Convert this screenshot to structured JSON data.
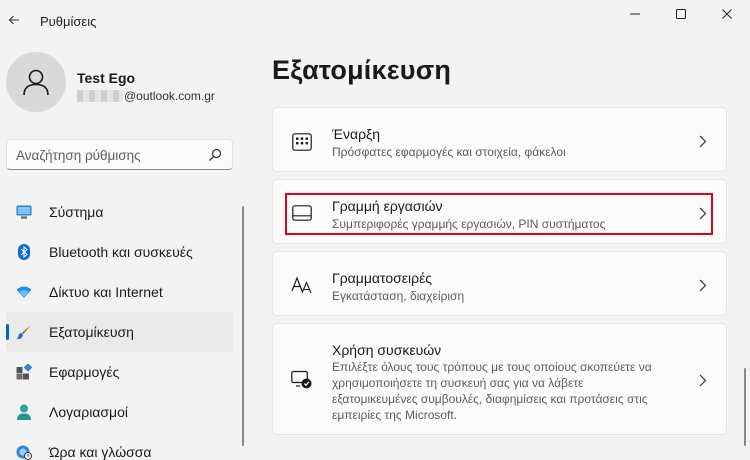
{
  "window": {
    "title": "Ρυθμίσεις"
  },
  "user": {
    "name": "Test Ego",
    "email_domain": "@outlook.com.gr"
  },
  "search": {
    "placeholder": "Αναζήτηση ρύθμισης"
  },
  "sidebar": {
    "items": [
      {
        "label": "Σύστημα",
        "icon": "system-icon",
        "active": false
      },
      {
        "label": "Bluetooth και συσκευές",
        "icon": "bluetooth-icon",
        "active": false
      },
      {
        "label": "Δίκτυο και Internet",
        "icon": "wifi-icon",
        "active": false
      },
      {
        "label": "Εξατομίκευση",
        "icon": "brush-icon",
        "active": true
      },
      {
        "label": "Εφαρμογές",
        "icon": "apps-icon",
        "active": false
      },
      {
        "label": "Λογαριασμοί",
        "icon": "person-icon",
        "active": false
      },
      {
        "label": "Ώρα και γλώσσα",
        "icon": "globe-clock-icon",
        "active": false
      }
    ]
  },
  "main": {
    "title": "Εξατομίκευση",
    "cards": [
      {
        "title": "Έναρξη",
        "desc": "Πρόσφατες εφαρμογές και στοιχεία, φάκελοι",
        "icon": "start-menu-icon"
      },
      {
        "title": "Γραμμή εργασιών",
        "desc": "Συμπεριφορές γραμμής εργασιών, PIN συστήματος",
        "icon": "taskbar-icon",
        "highlighted": true
      },
      {
        "title": "Γραμματοσειρές",
        "desc": "Εγκατάσταση, διαχείριση",
        "icon": "fonts-icon"
      },
      {
        "title": "Χρήση συσκευών",
        "desc_lines": [
          "Επιλέξτε όλους τους τρόπους με τους οποίους σκοπεύετε να",
          "χρησιμοποιήσετε τη συσκευή σας για να λάβετε",
          "εξατομικευμένες συμβουλές, διαφημίσεις και προτάσεις στις",
          "εμπειρίες της Microsoft."
        ],
        "icon": "device-usage-icon"
      }
    ]
  },
  "colors": {
    "accent": "#0067c0",
    "highlight": "#e3001b",
    "background": "#f3f3f3",
    "card": "#fbfbfb"
  }
}
